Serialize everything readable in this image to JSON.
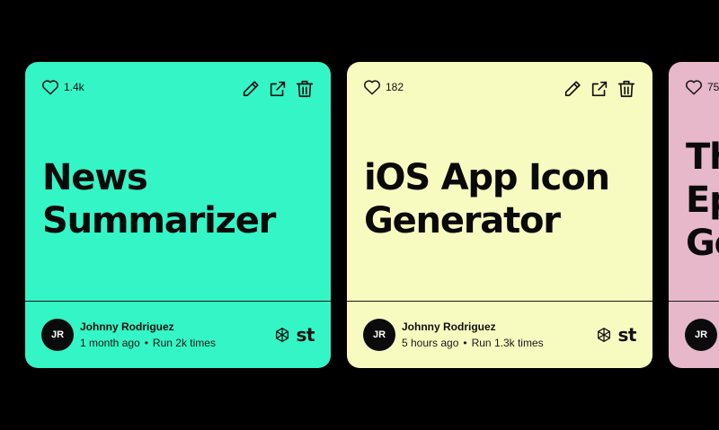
{
  "cards": [
    {
      "likes": "1.4k",
      "title_line1": "News",
      "title_line2": "Summarizer",
      "author_initials": "JR",
      "author_name": "Johnny Rodriguez",
      "time": "1 month ago",
      "separator": "•",
      "runs": "Run 2k times",
      "brand": "st",
      "color": "#34F5C5"
    },
    {
      "likes": "182",
      "title_line1": "iOS App Icon",
      "title_line2": "Generator",
      "author_initials": "JR",
      "author_name": "Johnny Rodriguez",
      "time": "5 hours ago",
      "separator": "•",
      "runs": "Run 1.3k times",
      "brand": "st",
      "color": "#F8FBC0"
    },
    {
      "likes": "75",
      "title_line1": "Th",
      "title_line2": "Ep",
      "title_line3": "Go",
      "author_initials": "JR",
      "color": "#E7B8CA"
    }
  ],
  "icons": {
    "like": "heart-icon",
    "edit": "pencil-icon",
    "open": "external-link-icon",
    "delete": "trash-icon",
    "brand": "openai-logo-icon"
  }
}
